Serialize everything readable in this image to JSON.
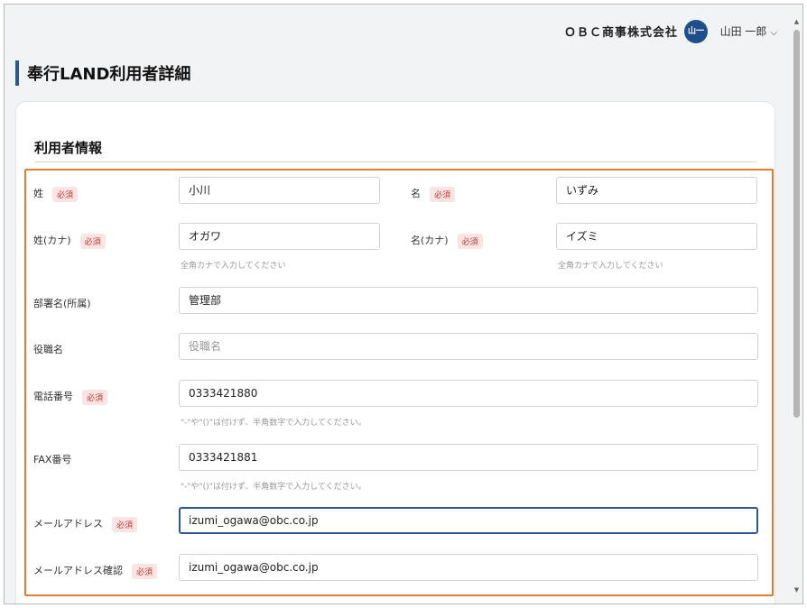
{
  "header": {
    "company": "ＯＢＣ商事株式会社",
    "avatar": "山一",
    "user": "山田 一郎"
  },
  "page": {
    "title": "奉行LAND利用者詳細"
  },
  "section": {
    "title": "利用者情報"
  },
  "required_badge": "必須",
  "fields": {
    "sei": {
      "label": "姓",
      "value": "小川"
    },
    "mei": {
      "label": "名",
      "value": "いずみ"
    },
    "sei_kana": {
      "label": "姓(カナ)",
      "value": "オガワ",
      "hint": "全角カナで入力してください"
    },
    "mei_kana": {
      "label": "名(カナ)",
      "value": "イズミ",
      "hint": "全角カナで入力してください"
    },
    "department": {
      "label": "部署名(所属)",
      "value": "管理部"
    },
    "position": {
      "label": "役職名",
      "value": "",
      "placeholder": "役職名"
    },
    "phone": {
      "label": "電話番号",
      "value": "0333421880",
      "hint": "\"-\"や\"()\"は付けず、半角数字で入力してください。"
    },
    "fax": {
      "label": "FAX番号",
      "value": "0333421881",
      "hint": "\"-\"や\"()\"は付けず、半角数字で入力してください。"
    },
    "email": {
      "label": "メールアドレス",
      "value": "izumi_ogawa@obc.co.jp"
    },
    "email_confirm": {
      "label": "メールアドレス確認",
      "value": "izumi_ogawa@obc.co.jp"
    }
  },
  "colors": {
    "accent": "#2a5a96",
    "highlight": "#e07c2c",
    "required": "#c0392b"
  },
  "icons": {
    "user_menu": "chevron-down-icon",
    "scroll_up": "scroll-up-arrow-icon",
    "scroll_down": "scroll-down-arrow-icon"
  }
}
